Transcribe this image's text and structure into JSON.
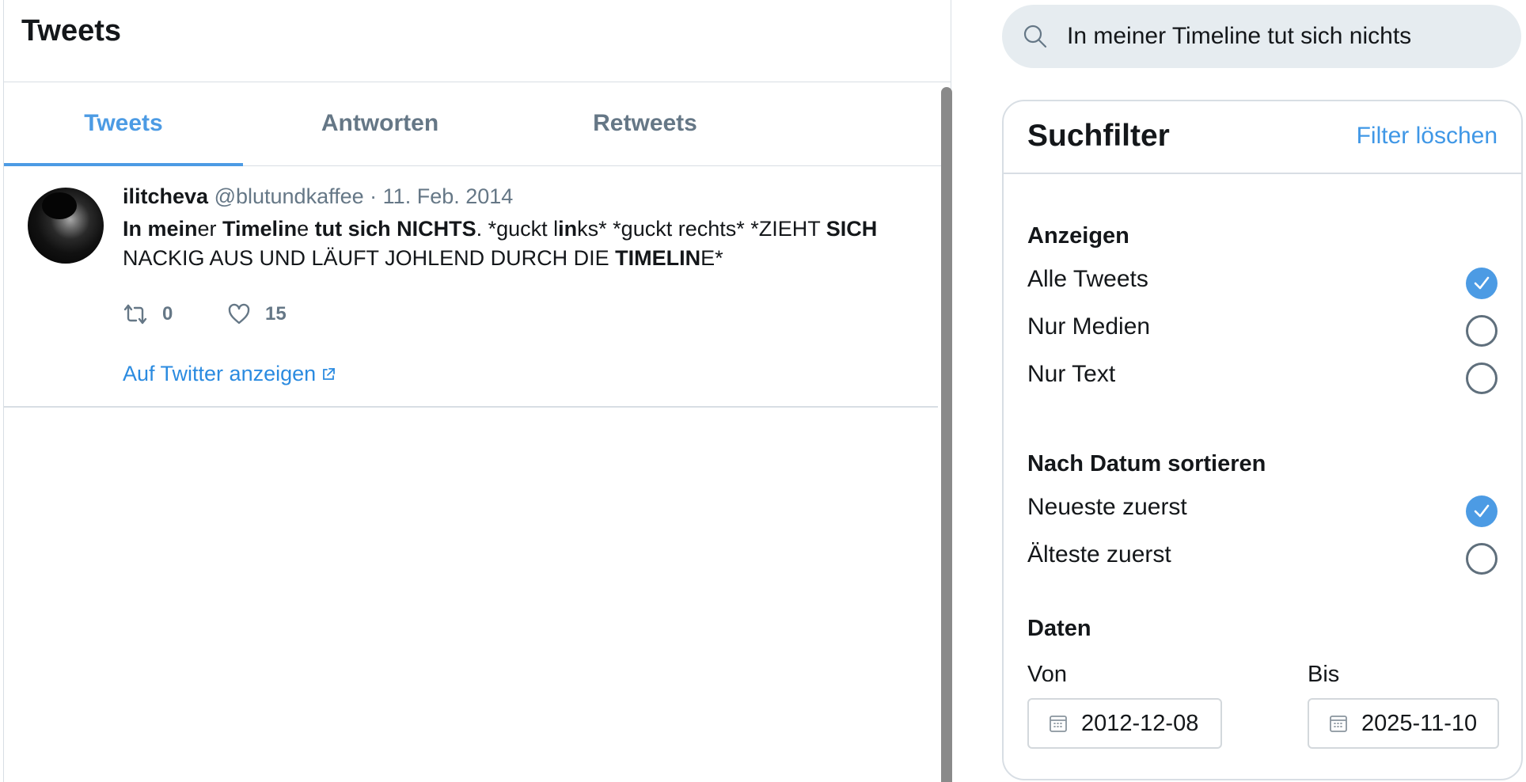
{
  "feed": {
    "title": "Tweets"
  },
  "tabs": [
    {
      "label": "Tweets",
      "active": true
    },
    {
      "label": "Antworten",
      "active": false
    },
    {
      "label": "Retweets",
      "active": false
    }
  ],
  "tweet": {
    "name": "ilitcheva",
    "handle": "@blutundkaffee",
    "separator": "·",
    "date": "11. Feb. 2014",
    "text_segments": [
      {
        "text": "In mein",
        "bold": true
      },
      {
        "text": "er ",
        "bold": false
      },
      {
        "text": "Timelin",
        "bold": true
      },
      {
        "text": "e ",
        "bold": false
      },
      {
        "text": "tut sich NICHTS",
        "bold": true
      },
      {
        "text": ". *guckt l",
        "bold": false
      },
      {
        "text": "in",
        "bold": true
      },
      {
        "text": "ks* *guckt rechts* *ZIEHT ",
        "bold": false
      },
      {
        "text": "SICH",
        "bold": true
      },
      {
        "text": " NACKIG AUS UND LÄUFT JOHLEND DURCH DIE ",
        "bold": false
      },
      {
        "text": "TIMELIN",
        "bold": true
      },
      {
        "text": "E*",
        "bold": false
      }
    ],
    "retweet_count": "0",
    "like_count": "15",
    "link_label": "Auf Twitter anzeigen"
  },
  "search": {
    "value": "In meiner Timeline tut sich nichts"
  },
  "filters": {
    "title": "Suchfilter",
    "clear_label": "Filter löschen",
    "show_title": "Anzeigen",
    "show_options": [
      {
        "label": "Alle Tweets",
        "checked": true
      },
      {
        "label": "Nur Medien",
        "checked": false
      },
      {
        "label": "Nur Text",
        "checked": false
      }
    ],
    "sort_title": "Nach Datum sortieren",
    "sort_options": [
      {
        "label": "Neueste zuerst",
        "checked": true
      },
      {
        "label": "Älteste zuerst",
        "checked": false
      }
    ],
    "dates_title": "Daten",
    "from_label": "Von",
    "from_value": "2012-12-08",
    "to_label": "Bis",
    "to_value": "2025-11-10"
  },
  "colors": {
    "accent": "#4c9be4",
    "link": "#2b8be0",
    "muted": "#657786",
    "border": "#d8dee4",
    "search_bg": "#e6ecf0"
  },
  "icons": [
    "search-icon",
    "retweet-icon",
    "heart-icon",
    "external-link-icon",
    "calendar-icon",
    "checkmark-icon"
  ]
}
